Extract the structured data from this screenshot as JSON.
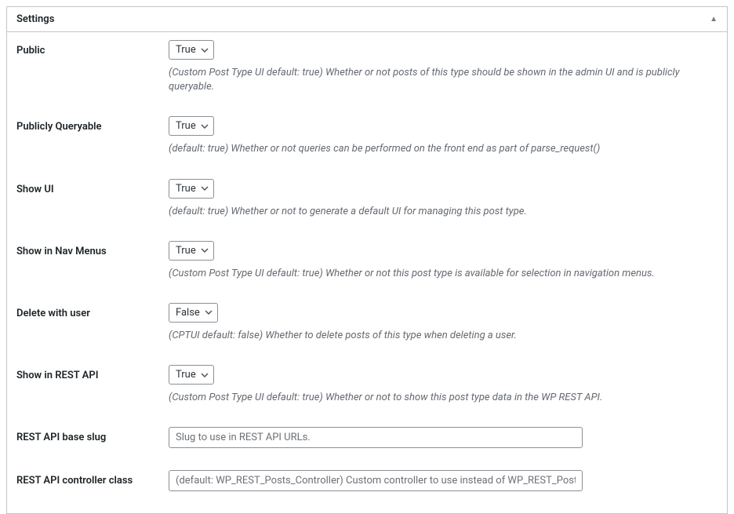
{
  "panel": {
    "title": "Settings"
  },
  "fields": {
    "public": {
      "label": "Public",
      "value": "True",
      "desc": "(Custom Post Type UI default: true) Whether or not posts of this type should be shown in the admin UI and is publicly queryable."
    },
    "publicly_queryable": {
      "label": "Publicly Queryable",
      "value": "True",
      "desc": "(default: true) Whether or not queries can be performed on the front end as part of parse_request()"
    },
    "show_ui": {
      "label": "Show UI",
      "value": "True",
      "desc": "(default: true) Whether or not to generate a default UI for managing this post type."
    },
    "show_in_nav_menus": {
      "label": "Show in Nav Menus",
      "value": "True",
      "desc": "(Custom Post Type UI default: true) Whether or not this post type is available for selection in navigation menus."
    },
    "delete_with_user": {
      "label": "Delete with user",
      "value": "False",
      "desc": "(CPTUI default: false) Whether to delete posts of this type when deleting a user."
    },
    "show_in_rest": {
      "label": "Show in REST API",
      "value": "True",
      "desc": "(Custom Post Type UI default: true) Whether or not to show this post type data in the WP REST API."
    },
    "rest_base": {
      "label": "REST API base slug",
      "placeholder": "Slug to use in REST API URLs."
    },
    "rest_controller_class": {
      "label": "REST API controller class",
      "placeholder": "(default: WP_REST_Posts_Controller) Custom controller to use instead of WP_REST_Posts_Controller."
    }
  },
  "options": {
    "true": "True",
    "false": "False"
  }
}
